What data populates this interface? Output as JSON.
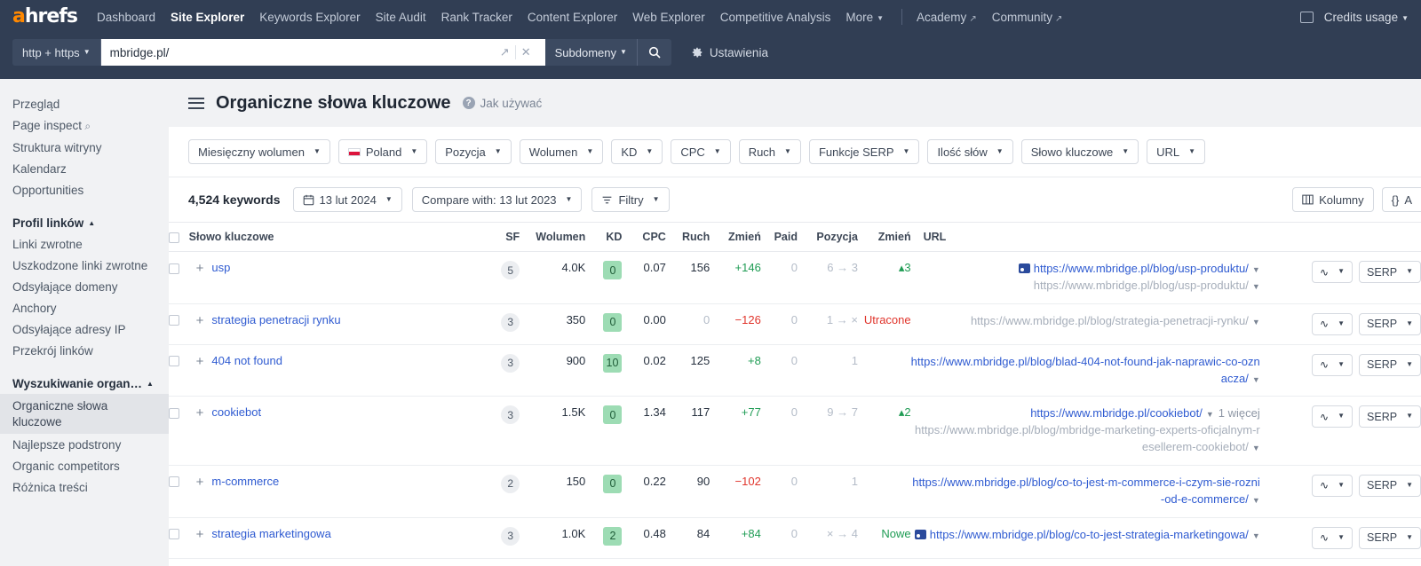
{
  "topnav": {
    "logo": "ahrefs",
    "items": [
      {
        "label": "Dashboard",
        "active": false
      },
      {
        "label": "Site Explorer",
        "active": true
      },
      {
        "label": "Keywords Explorer",
        "active": false
      },
      {
        "label": "Site Audit",
        "active": false
      },
      {
        "label": "Rank Tracker",
        "active": false
      },
      {
        "label": "Content Explorer",
        "active": false
      },
      {
        "label": "Web Explorer",
        "active": false
      },
      {
        "label": "Competitive Analysis",
        "active": false
      },
      {
        "label": "More",
        "active": false,
        "caret": true
      }
    ],
    "links": [
      {
        "label": "Academy",
        "external": true
      },
      {
        "label": "Community",
        "external": true
      }
    ],
    "credits_label": "Credits usage"
  },
  "searchbar": {
    "protocol": "http + https",
    "url_value": "mbridge.pl/",
    "scope": "Subdomeny",
    "settings_label": "Ustawienia"
  },
  "sidebar": {
    "items": [
      {
        "label": "Przegląd",
        "type": "item"
      },
      {
        "label": "Page inspect",
        "type": "item",
        "icon": "search-icon"
      },
      {
        "label": "Struktura witryny",
        "type": "item"
      },
      {
        "label": "Kalendarz",
        "type": "item"
      },
      {
        "label": "Opportunities",
        "type": "item"
      },
      {
        "label": "Profil linków",
        "type": "group"
      },
      {
        "label": "Linki zwrotne",
        "type": "item"
      },
      {
        "label": "Uszkodzone linki zwrotne",
        "type": "item"
      },
      {
        "label": "Odsyłające domeny",
        "type": "item"
      },
      {
        "label": "Anchory",
        "type": "item"
      },
      {
        "label": "Odsyłające adresy IP",
        "type": "item"
      },
      {
        "label": "Przekrój linków",
        "type": "item"
      },
      {
        "label": "Wyszukiwanie organ…",
        "type": "group"
      },
      {
        "label": "Organiczne słowa kluczowe",
        "type": "item",
        "active": true
      },
      {
        "label": "Najlepsze podstrony",
        "type": "item"
      },
      {
        "label": "Organic competitors",
        "type": "item"
      },
      {
        "label": "Różnica treści",
        "type": "item"
      }
    ]
  },
  "page": {
    "title": "Organiczne słowa kluczowe",
    "howto": "Jak używać"
  },
  "filters": [
    {
      "label": "Miesięczny wolumen"
    },
    {
      "label": "Poland",
      "flag": "pl"
    },
    {
      "label": "Pozycja"
    },
    {
      "label": "Wolumen"
    },
    {
      "label": "KD"
    },
    {
      "label": "CPC"
    },
    {
      "label": "Ruch"
    },
    {
      "label": "Funkcje SERP"
    },
    {
      "label": "Ilość słów"
    },
    {
      "label": "Słowo kluczowe"
    },
    {
      "label": "URL"
    }
  ],
  "toolbar": {
    "keywords_count": "4,524 keywords",
    "date": "13 lut 2024",
    "compare": "Compare with: 13 lut 2023",
    "filters_label": "Filtry",
    "columns_label": "Kolumny",
    "api_label": "A"
  },
  "table": {
    "columns": [
      "Słowo kluczowe",
      "SF",
      "Wolumen",
      "KD",
      "CPC",
      "Ruch",
      "Zmień",
      "Paid",
      "Pozycja",
      "Zmień",
      "URL"
    ],
    "rows": [
      {
        "keyword": "usp",
        "sf": "5",
        "volume": "4.0K",
        "kd": "0",
        "cpc": "0.07",
        "traffic": "156",
        "traffic_change": "+146",
        "traffic_change_dir": "up",
        "paid": "0",
        "position": "6 → 3",
        "pos_change": "▴3",
        "pos_change_dir": "up",
        "url_icon": "serp-feature-icon",
        "url_main": "https://www.mbridge.pl/blog/usp-produktu/",
        "url_sub": "https://www.mbridge.pl/blog/usp-produktu/",
        "more": "",
        "chart_btn": "chart-icon",
        "serp_btn": "SERP"
      },
      {
        "keyword": "strategia penetracji rynku",
        "sf": "3",
        "volume": "350",
        "kd": "0",
        "cpc": "0.00",
        "traffic": "0",
        "traffic_muted": true,
        "traffic_change": "−126",
        "traffic_change_dir": "down",
        "paid": "0",
        "position": "1 → ×",
        "pos_change": "Utracone",
        "pos_change_dir": "lost",
        "url_icon": "",
        "url_main": "",
        "url_sub": "https://www.mbridge.pl/blog/strategia-penetracji-rynku/",
        "more": "",
        "chart_btn": "chart-icon",
        "serp_btn": "SERP"
      },
      {
        "keyword": "404 not found",
        "sf": "3",
        "volume": "900",
        "kd": "10",
        "cpc": "0.02",
        "traffic": "125",
        "traffic_change": "+8",
        "traffic_change_dir": "up",
        "paid": "0",
        "position": "1",
        "pos_change": "",
        "pos_change_dir": "",
        "url_icon": "",
        "url_main": "https://www.mbridge.pl/blog/blad-404-not-found-jak-naprawic-co-oznacza/",
        "url_sub": "",
        "more": "",
        "chart_btn": "chart-icon",
        "serp_btn": "SERP"
      },
      {
        "keyword": "cookiebot",
        "sf": "3",
        "volume": "1.5K",
        "kd": "0",
        "cpc": "1.34",
        "traffic": "117",
        "traffic_change": "+77",
        "traffic_change_dir": "up",
        "paid": "0",
        "position": "9 → 7",
        "pos_change": "▴2",
        "pos_change_dir": "up",
        "url_icon": "",
        "url_main": "https://www.mbridge.pl/cookiebot/",
        "url_sub": "https://www.mbridge.pl/blog/mbridge-marketing-experts-oficjalnym-resellerem-cookiebot/",
        "more": "1 więcej",
        "chart_btn": "chart-icon",
        "serp_btn": "SERP"
      },
      {
        "keyword": "m-commerce",
        "sf": "2",
        "volume": "150",
        "kd": "0",
        "cpc": "0.22",
        "traffic": "90",
        "traffic_change": "−102",
        "traffic_change_dir": "down",
        "paid": "0",
        "position": "1",
        "pos_change": "",
        "pos_change_dir": "",
        "url_icon": "",
        "url_main": "https://www.mbridge.pl/blog/co-to-jest-m-commerce-i-czym-sie-rozni-od-e-commerce/",
        "url_sub": "",
        "more": "",
        "chart_btn": "chart-icon",
        "serp_btn": "SERP"
      },
      {
        "keyword": "strategia marketingowa",
        "sf": "3",
        "volume": "1.0K",
        "kd": "2",
        "cpc": "0.48",
        "traffic": "84",
        "traffic_change": "+84",
        "traffic_change_dir": "up",
        "paid": "0",
        "position": "× → 4",
        "pos_change": "Nowe",
        "pos_change_dir": "new",
        "url_icon": "serp-feature-icon",
        "url_main": "https://www.mbridge.pl/blog/co-to-jest-strategia-marketingowa/",
        "url_sub": "",
        "more": "",
        "chart_btn": "chart-icon",
        "serp_btn": "SERP"
      }
    ]
  },
  "colors": {
    "nav_bg": "#313e54",
    "accent_orange": "#ff8800",
    "link_blue": "#2f5bd1",
    "up_green": "#1f9c54",
    "down_red": "#e0342b",
    "kd_badge": "#9ddcb4"
  }
}
